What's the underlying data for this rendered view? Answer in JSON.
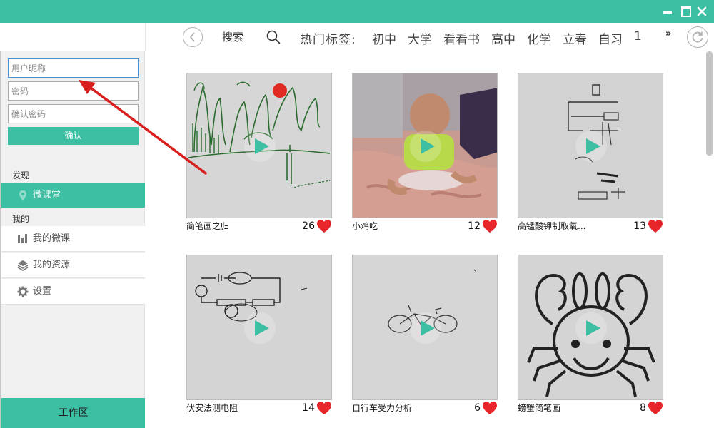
{
  "window": {
    "controls": [
      "minimize-icon",
      "maximize-icon",
      "close-icon"
    ]
  },
  "nav": {
    "search_placeholder": "搜索",
    "hot_label": "热门标签:",
    "tags": [
      "初中",
      "大学",
      "看看书",
      "高中",
      "化学",
      "立春",
      "自习",
      "1"
    ],
    "more": "»"
  },
  "sidebar": {
    "nickname_placeholder": "用户昵称",
    "password_placeholder": "密码",
    "confirm_password_placeholder": "确认密码",
    "confirm_label": "确认",
    "discover_title": "发现",
    "micro_class_hall": "微课堂",
    "mine_title": "我的",
    "my_micro_class": "我的微课",
    "my_resources": "我的资源",
    "settings": "设置",
    "workspace": "工作区"
  },
  "videos": [
    {
      "title": "简笔画之归",
      "likes": "26"
    },
    {
      "title": "小鸡吃",
      "likes": "12"
    },
    {
      "title": "高锰酸钾制取氧...",
      "likes": "13"
    },
    {
      "title": "伏安法测电阻",
      "likes": "14"
    },
    {
      "title": "自行车受力分析",
      "likes": "6"
    },
    {
      "title": "螃蟹简笔画",
      "likes": "8"
    }
  ],
  "colors": {
    "accent": "#3dbfa4",
    "heart": "#e8252a"
  }
}
